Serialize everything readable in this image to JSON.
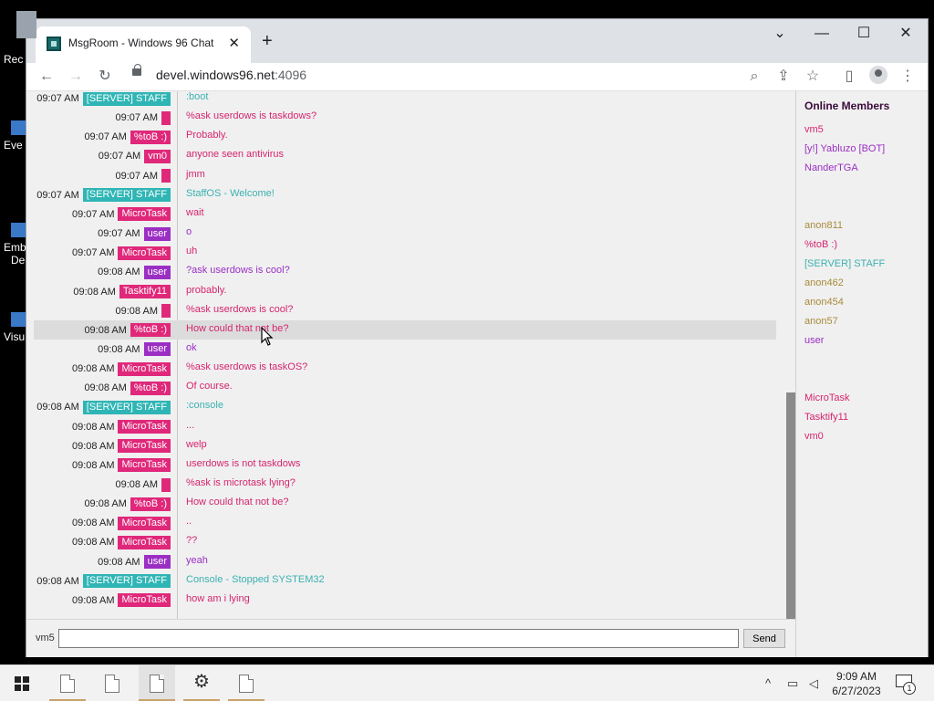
{
  "desktop": {
    "icons": [
      {
        "label": "Rec",
        "icon": "recycle-bin-icon"
      },
      {
        "label": "Eve",
        "icon": "shortcut-icon"
      },
      {
        "label": "Emb\nDe",
        "icon": "shortcut-icon"
      },
      {
        "label": "Visu",
        "icon": "shortcut-icon"
      }
    ]
  },
  "browser": {
    "tab_title": "MsgRoom - Windows 96 Chat",
    "tab_close": "✕",
    "new_tab": "+",
    "url_host": "devel.windows96.net",
    "url_port": ":4096",
    "icons": {
      "back": "←",
      "forward": "→",
      "reload": "↻",
      "search": "⌕",
      "share": "⇪",
      "bookmark": "☆",
      "sidepanel": "▯",
      "menu": "⋮",
      "tab_list": "⌄",
      "minimize": "—",
      "maximize": "☐",
      "close": "✕"
    }
  },
  "chat": {
    "colors": {
      "server": "#2fb5b5",
      "pink": "#e0287a",
      "user": "#9b2fc4",
      "text_pink": "#d6246f",
      "text_purple": "#9b2fc4",
      "text_teal": "#3bb1b1",
      "text_gray": "#8a8a8a"
    },
    "messages": [
      {
        "time": "09:07 AM",
        "user": "[SERVER] STAFF",
        "kind": "server",
        "text": ":boot",
        "text_kind": "teal"
      },
      {
        "time": "09:07 AM",
        "user": "",
        "kind": "pink",
        "text": "%ask userdows is taskdows?",
        "text_kind": "pink"
      },
      {
        "time": "09:07 AM",
        "user": "%toB :)",
        "kind": "pink",
        "text": "Probably.",
        "text_kind": "pink"
      },
      {
        "time": "09:07 AM",
        "user": "vm0",
        "kind": "pink",
        "text": "anyone seen antivirus",
        "text_kind": "pink"
      },
      {
        "time": "09:07 AM",
        "user": "",
        "kind": "pink",
        "text": "jmm",
        "text_kind": "pink"
      },
      {
        "time": "09:07 AM",
        "user": "[SERVER] STAFF",
        "kind": "server",
        "text": "StaffOS - Welcome!",
        "text_kind": "teal"
      },
      {
        "time": "09:07 AM",
        "user": "MicroTask",
        "kind": "pink",
        "text": "wait",
        "text_kind": "pink"
      },
      {
        "time": "09:07 AM",
        "user": "user",
        "kind": "user",
        "text": "o",
        "text_kind": "purple"
      },
      {
        "time": "09:07 AM",
        "user": "MicroTask",
        "kind": "pink",
        "text": "uh",
        "text_kind": "pink"
      },
      {
        "time": "09:08 AM",
        "user": "user",
        "kind": "user",
        "text": "?ask userdows is cool?",
        "text_kind": "purple"
      },
      {
        "time": "09:08 AM",
        "user": "Tasktify11",
        "kind": "pink",
        "text": "probably.",
        "text_kind": "pink"
      },
      {
        "time": "09:08 AM",
        "user": "",
        "kind": "pink",
        "text": "%ask userdows is cool?",
        "text_kind": "pink"
      },
      {
        "time": "09:08 AM",
        "user": "%toB :)",
        "kind": "pink",
        "text": "How could that not be?",
        "text_kind": "pink",
        "hover": true
      },
      {
        "time": "09:08 AM",
        "user": "user",
        "kind": "user",
        "text": "ok",
        "text_kind": "purple"
      },
      {
        "time": "09:08 AM",
        "user": "MicroTask",
        "kind": "pink",
        "text": "%ask userdows is taskOS?",
        "text_kind": "pink"
      },
      {
        "time": "09:08 AM",
        "user": "%toB :)",
        "kind": "pink",
        "text": "Of course.",
        "text_kind": "pink"
      },
      {
        "time": "09:08 AM",
        "user": "[SERVER] STAFF",
        "kind": "server",
        "text": ":console",
        "text_kind": "teal"
      },
      {
        "time": "09:08 AM",
        "user": "MicroTask",
        "kind": "pink",
        "text": "...",
        "text_kind": "pink"
      },
      {
        "time": "09:08 AM",
        "user": "MicroTask",
        "kind": "pink",
        "text": "welp",
        "text_kind": "pink"
      },
      {
        "time": "09:08 AM",
        "user": "MicroTask",
        "kind": "pink",
        "text": "userdows is not taskdows",
        "text_kind": "pink"
      },
      {
        "time": "09:08 AM",
        "user": "",
        "kind": "pink",
        "text": "%ask is microtask lying?",
        "text_kind": "pink"
      },
      {
        "time": "09:08 AM",
        "user": "%toB :)",
        "kind": "pink",
        "text": "How could that not be?",
        "text_kind": "pink"
      },
      {
        "time": "09:08 AM",
        "user": "MicroTask",
        "kind": "pink",
        "text": "..",
        "text_kind": "pink"
      },
      {
        "time": "09:08 AM",
        "user": "MicroTask",
        "kind": "pink",
        "text": "??",
        "text_kind": "pink"
      },
      {
        "time": "09:08 AM",
        "user": "user",
        "kind": "user",
        "text": "yeah",
        "text_kind": "purple"
      },
      {
        "time": "09:08 AM",
        "user": "[SERVER] STAFF",
        "kind": "server",
        "text": "Console - Stopped SYSTEM32",
        "text_kind": "teal"
      },
      {
        "time": "09:08 AM",
        "user": "MicroTask",
        "kind": "pink",
        "text": "how am i lying",
        "text_kind": "pink"
      }
    ],
    "input": {
      "nick": "vm5",
      "value": "",
      "send_label": "Send"
    }
  },
  "members": {
    "title": "Online Members",
    "groups": [
      [
        {
          "name": "vm5",
          "color": "#d6246f"
        },
        {
          "name": "[y!] Yabluzo [BOT]",
          "color": "#9b2fc4"
        },
        {
          "name": "NanderTGA",
          "color": "#9b2fc4"
        }
      ],
      [
        {
          "name": "anon811",
          "color": "#a88b3a"
        },
        {
          "name": "%toB :)",
          "color": "#d6246f"
        },
        {
          "name": "[SERVER] STAFF",
          "color": "#3bb1b1"
        },
        {
          "name": "anon462",
          "color": "#a88b3a"
        },
        {
          "name": "anon454",
          "color": "#a88b3a"
        },
        {
          "name": "anon57",
          "color": "#a88b3a"
        },
        {
          "name": "user",
          "color": "#9b2fc4"
        }
      ],
      [
        {
          "name": "MicroTask",
          "color": "#d6246f"
        },
        {
          "name": "Tasktify11",
          "color": "#d6246f"
        },
        {
          "name": "vm0",
          "color": "#d6246f"
        }
      ]
    ]
  },
  "taskbar": {
    "time": "9:09 AM",
    "date": "6/27/2023",
    "notification_count": "1",
    "tray_icons": {
      "chevron": "^",
      "network": "▭",
      "volume": "◁"
    }
  }
}
